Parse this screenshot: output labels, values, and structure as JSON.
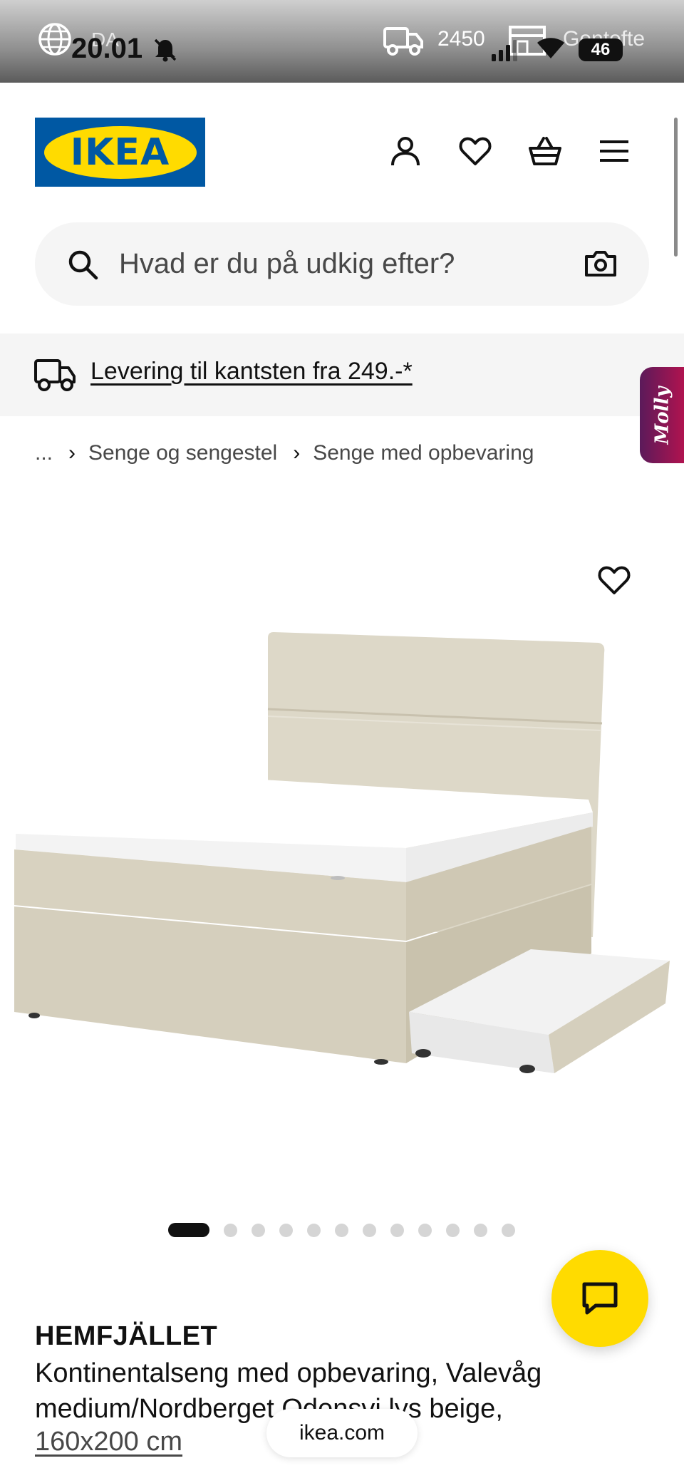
{
  "status_bar": {
    "language": "DA",
    "time": "20.01",
    "postal_code": "2450",
    "store_name": "Gentofte",
    "battery": "46"
  },
  "header": {
    "logo_text": "IKEA",
    "icons": [
      "account-icon",
      "heart-icon",
      "shopping-basket-icon",
      "hamburger-menu-icon"
    ]
  },
  "search": {
    "placeholder": "Hvad er du på udkig efter?"
  },
  "delivery_banner": {
    "text": "Levering til kantsten fra 249.-*"
  },
  "chat_assistant": {
    "label": "Molly"
  },
  "breadcrumb": {
    "items": [
      "...",
      "Senge og sengestel",
      "Senge med opbevaring"
    ]
  },
  "carousel": {
    "total_images": 12,
    "active_index": 0
  },
  "product": {
    "name": "HEMFJÄLLET",
    "description": "Kontinentalseng med opbevaring, Valevåg medium/Nordberget Odensvi lys beige,",
    "size": "160x200 cm"
  },
  "browser": {
    "url": "ikea.com"
  },
  "colors": {
    "ikea_blue": "#0058a3",
    "ikea_yellow": "#ffdb00",
    "molly_gradient_start": "#5b1a5a",
    "molly_gradient_end": "#b0134f",
    "banner_bg": "#f5f5f5",
    "bed_beige": "#d8d2c0"
  }
}
